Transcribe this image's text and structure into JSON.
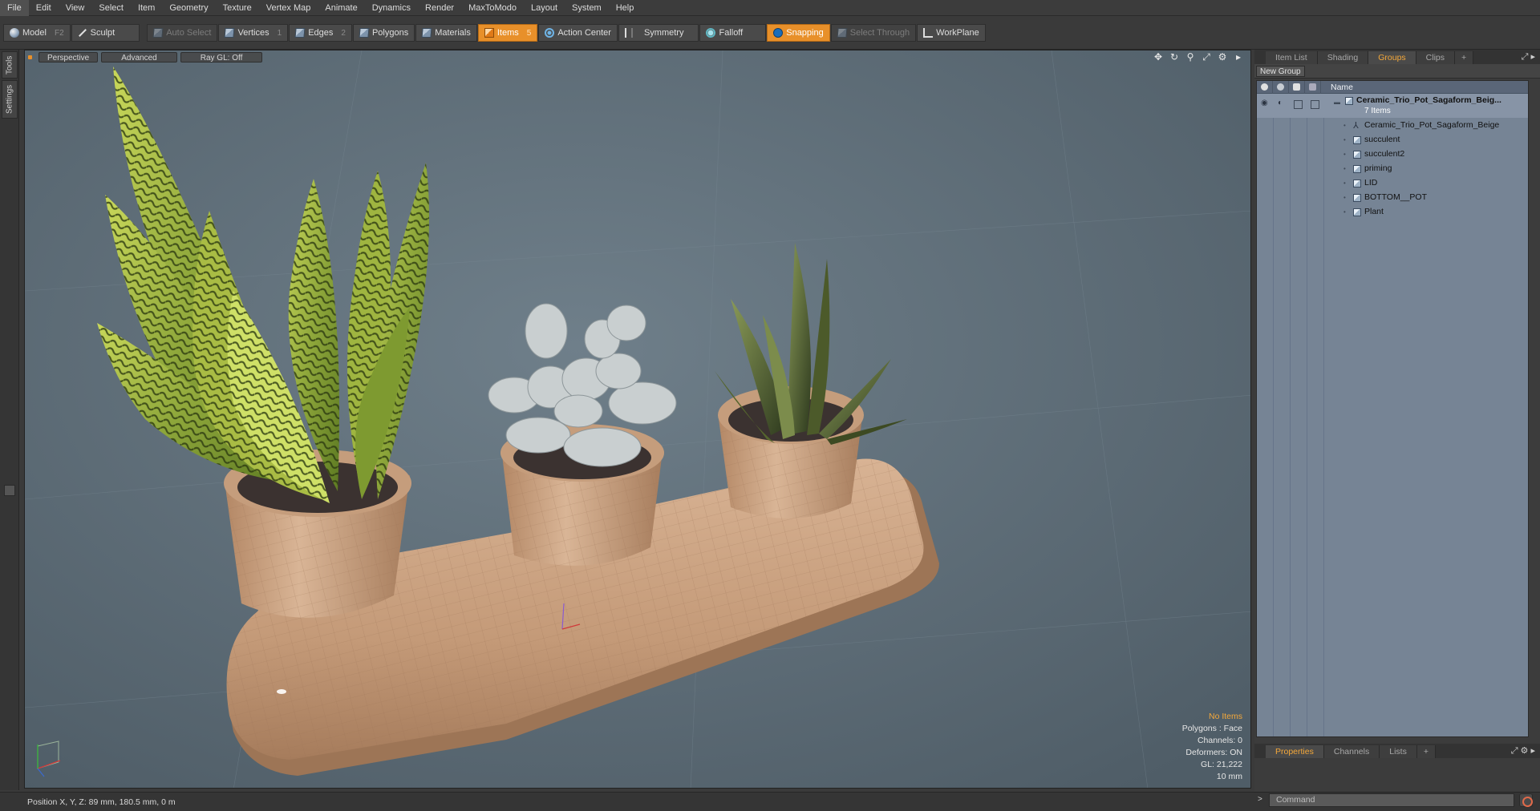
{
  "menu": [
    "File",
    "Edit",
    "View",
    "Select",
    "Item",
    "Geometry",
    "Texture",
    "Vertex Map",
    "Animate",
    "Dynamics",
    "Render",
    "MaxToModo",
    "Layout",
    "System",
    "Help"
  ],
  "toolbar": {
    "model": "Model",
    "model_key": "F2",
    "sculpt": "Sculpt",
    "auto_select": "Auto Select",
    "vertices": "Vertices",
    "vertices_key": "1",
    "edges": "Edges",
    "edges_key": "2",
    "polygons": "Polygons",
    "materials": "Materials",
    "items": "Items",
    "items_key": "5",
    "action_center": "Action Center",
    "symmetry": "Symmetry",
    "falloff": "Falloff",
    "snapping": "Snapping",
    "select_through": "Select Through",
    "workplane": "WorkPlane"
  },
  "left_tabs": {
    "tools": "Tools",
    "settings": "Settings"
  },
  "viewport": {
    "view": "Perspective",
    "shading": "Advanced",
    "raygl": "Ray GL: Off",
    "info": {
      "no_items": "No Items",
      "polygons": "Polygons : Face",
      "channels": "Channels: 0",
      "deformers": "Deformers: ON",
      "gl": "GL: 21,222",
      "scale": "10 mm"
    }
  },
  "status": {
    "position": "Position X, Y, Z:  89 mm, 180.5 mm, 0 m"
  },
  "right_panel": {
    "tabs": [
      "Item List",
      "Shading",
      "Groups",
      "Clips"
    ],
    "active_tab": "Groups",
    "new_group": "New Group",
    "name_col": "Name",
    "group": {
      "name": "Ceramic_Trio_Pot_Sagaform_Beig...",
      "count": "7 Items"
    },
    "items": [
      "Ceramic_Trio_Pot_Sagaform_Beige",
      "succulent",
      "succulent2",
      "priming",
      "LID",
      "BOTTOM__POT",
      "Plant"
    ],
    "bottom_tabs": [
      "Properties",
      "Channels",
      "Lists"
    ],
    "active_bottom_tab": "Properties",
    "command_placeholder": "Command"
  },
  "colors": {
    "accent": "#e8902a",
    "viewport_bg": "#5b6b76",
    "pot": "#c49a78"
  }
}
